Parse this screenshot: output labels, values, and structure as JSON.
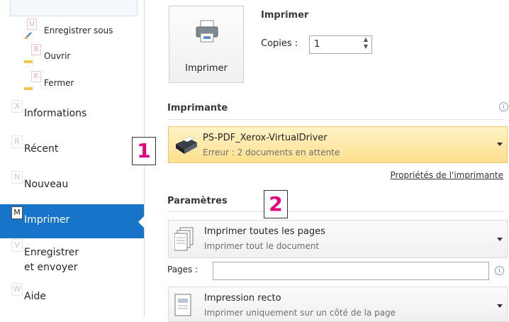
{
  "sidebar": {
    "sub_items": [
      {
        "key": "U",
        "label": "Enregistrer sous"
      },
      {
        "key": "B",
        "label": "Ouvrir"
      },
      {
        "key": "K",
        "label": "Fermer"
      }
    ],
    "categories": [
      {
        "key": "X",
        "label": "Informations",
        "label2": ""
      },
      {
        "key": "R",
        "label": "Récent",
        "label2": ""
      },
      {
        "key": "N",
        "label": "Nouveau",
        "label2": ""
      },
      {
        "key": "M",
        "label": "Imprimer",
        "label2": "",
        "active": true
      },
      {
        "key": "V",
        "label": "Enregistrer",
        "label2": "et envoyer"
      },
      {
        "key": "W",
        "label": "Aide",
        "label2": ""
      }
    ]
  },
  "print": {
    "section_title": "Imprimer",
    "button_label": "Imprimer",
    "copies_label": "Copies :",
    "copies_value": "1"
  },
  "printer": {
    "section_title": "Imprimante",
    "name": "PS-PDF_Xerox-VirtualDriver",
    "status": "Erreur : 2 documents en attente",
    "properties_link": "Propriétés de l'imprimante"
  },
  "settings": {
    "section_title": "Paramètres",
    "pages_option": {
      "title": "Imprimer toutes les pages",
      "subtitle": "Imprimer tout le document"
    },
    "pages_label": "Pages :",
    "pages_value": "",
    "sides_option": {
      "title": "Impression recto",
      "subtitle": "Imprimer uniquement sur un côté de la page"
    }
  },
  "callouts": [
    "1",
    "2"
  ],
  "colors": {
    "active_blue": "#1874c9",
    "printer_highlight": "#fde08d",
    "callout_text": "#e4007c"
  }
}
